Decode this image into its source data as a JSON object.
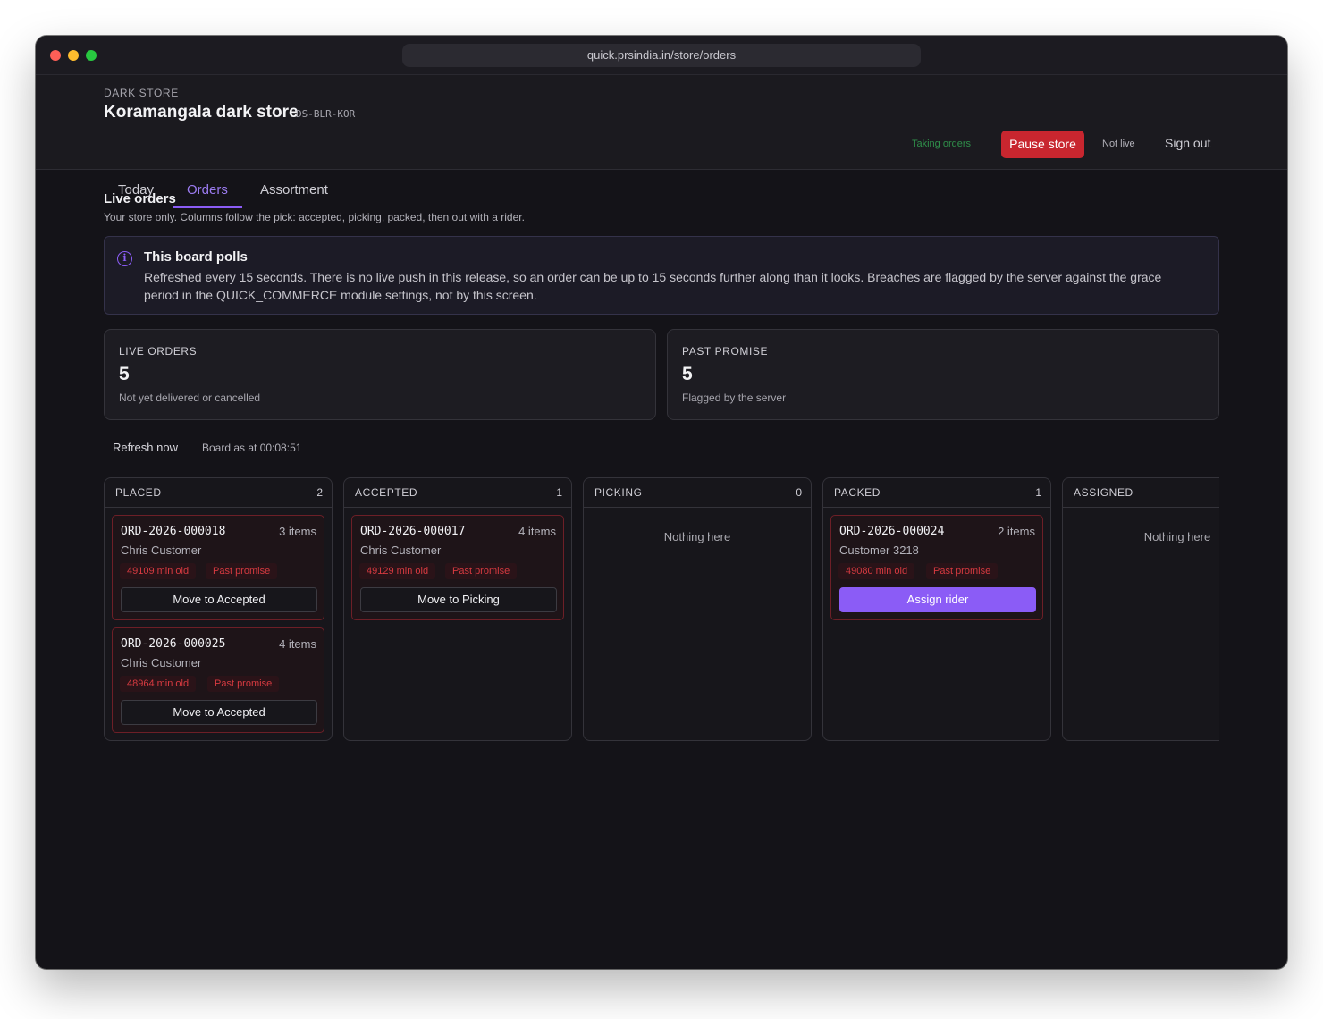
{
  "browser": {
    "url": "quick.prsindia.in/store/orders"
  },
  "header": {
    "eyebrow": "DARK STORE",
    "store_name": "Koramangala dark store",
    "store_code": "DS-BLR-KOR",
    "taking_orders": "Taking orders",
    "pause_label": "Pause store",
    "not_live": "Not live",
    "sign_out": "Sign out",
    "tabs": [
      {
        "label": "Today",
        "active": false
      },
      {
        "label": "Orders",
        "active": true
      },
      {
        "label": "Assortment",
        "active": false
      }
    ]
  },
  "section": {
    "title": "Live orders",
    "subtitle": "Your store only. Columns follow the pick: accepted, picking, packed, then out with a rider."
  },
  "info": {
    "title": "This board polls",
    "body": "Refreshed every 15 seconds. There is no live push in this release, so an order can be up to 15 seconds further along than it looks. Breaches are flagged by the server against the grace period in the QUICK_COMMERCE module settings, not by this screen."
  },
  "stats": [
    {
      "label": "LIVE ORDERS",
      "value": "5",
      "note": "Not yet delivered or cancelled"
    },
    {
      "label": "PAST PROMISE",
      "value": "5",
      "note": "Flagged by the server"
    }
  ],
  "toolbar": {
    "refresh": "Refresh now",
    "as_at": "Board as at 00:08:51"
  },
  "columns": [
    {
      "name": "PLACED",
      "count": "2",
      "cards": [
        {
          "id": "ORD-2026-000018",
          "items": "3 items",
          "customer": "Chris Customer",
          "age": "49109 min old",
          "flag": "Past promise",
          "action": "Move to Accepted",
          "primary": false
        },
        {
          "id": "ORD-2026-000025",
          "items": "4 items",
          "customer": "Chris Customer",
          "age": "48964 min old",
          "flag": "Past promise",
          "action": "Move to Accepted",
          "primary": false
        }
      ]
    },
    {
      "name": "ACCEPTED",
      "count": "1",
      "cards": [
        {
          "id": "ORD-2026-000017",
          "items": "4 items",
          "customer": "Chris Customer",
          "age": "49129 min old",
          "flag": "Past promise",
          "action": "Move to Picking",
          "primary": false
        }
      ]
    },
    {
      "name": "PICKING",
      "count": "0",
      "empty": "Nothing here"
    },
    {
      "name": "PACKED",
      "count": "1",
      "cards": [
        {
          "id": "ORD-2026-000024",
          "items": "2 items",
          "customer": "Customer 3218",
          "age": "49080 min old",
          "flag": "Past promise",
          "action": "Assign rider",
          "primary": true
        }
      ]
    },
    {
      "name": "ASSIGNED",
      "empty": "Nothing here"
    }
  ]
}
